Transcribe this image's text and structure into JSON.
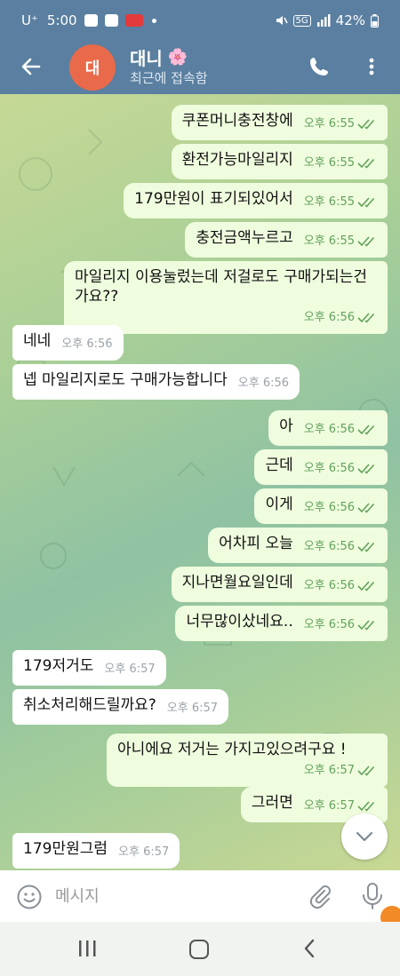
{
  "status_bar": {
    "carrier": "U⁺",
    "time": "5:00",
    "battery": "42%",
    "network": "5G"
  },
  "header": {
    "avatar_initial": "대",
    "contact_name": "대니",
    "name_emoji": "🌸",
    "last_seen": "최근에 접속함",
    "avatar_color": "#e86a4a",
    "header_color": "#5a7fa0"
  },
  "messages": [
    {
      "dir": "out",
      "text": "쿠폰머니충전창에",
      "time": "오후 6:55",
      "read": true
    },
    {
      "dir": "out",
      "text": "환전가능마일리지",
      "time": "오후 6:55",
      "read": true
    },
    {
      "dir": "out",
      "text": "179만원이 표기되있어서",
      "time": "오후 6:55",
      "read": true
    },
    {
      "dir": "out",
      "text": "충전금액누르고",
      "time": "오후 6:55",
      "read": true
    },
    {
      "dir": "out",
      "text": "마일리지 이용눌렀는데 저걸로도 구매가되는건가요??",
      "time": "오후 6:56",
      "read": true
    },
    {
      "dir": "in",
      "text": "네네",
      "time": "오후 6:56"
    },
    {
      "dir": "in",
      "text": "넵 마일리지로도 구매가능합니다",
      "time": "오후 6:56"
    },
    {
      "dir": "out",
      "text": "아",
      "time": "오후 6:56",
      "read": true
    },
    {
      "dir": "out",
      "text": "근데",
      "time": "오후 6:56",
      "read": true
    },
    {
      "dir": "out",
      "text": "이게",
      "time": "오후 6:56",
      "read": true
    },
    {
      "dir": "out",
      "text": "어차피 오늘",
      "time": "오후 6:56",
      "read": true
    },
    {
      "dir": "out",
      "text": "지나면월요일인데",
      "time": "오후 6:56",
      "read": true
    },
    {
      "dir": "out",
      "text": "너무많이샀네요..",
      "time": "오후 6:56",
      "read": true
    },
    {
      "dir": "in",
      "text": "179저거도",
      "time": "오후 6:57"
    },
    {
      "dir": "in",
      "text": "취소처리해드릴까요?",
      "time": "오후 6:57"
    },
    {
      "dir": "out",
      "text": "아니에요 저거는 가지고있으려구요 !",
      "time": "오후 6:57",
      "read": true
    },
    {
      "dir": "out",
      "text": "그러면",
      "time": "오후 6:57",
      "read": true
    },
    {
      "dir": "in",
      "text": "179만원그럼",
      "time": "오후 6:57"
    }
  ],
  "input": {
    "placeholder": "메시지",
    "value": ""
  },
  "icons": {
    "back": "arrow-left-icon",
    "call": "phone-icon",
    "more": "more-vertical-icon",
    "emoji": "smile-icon",
    "attach": "paperclip-icon",
    "mic": "microphone-icon",
    "scroll_down": "chevron-down-icon"
  },
  "colors": {
    "outgoing_bubble": "#effdde",
    "incoming_bubble": "#ffffff",
    "read_tick": "#62a15b"
  }
}
